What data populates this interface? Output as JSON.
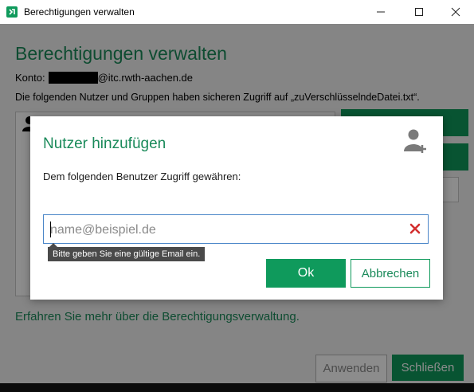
{
  "window": {
    "title": "Berechtigungen verwalten",
    "accent_color": "#0f9a5c",
    "icons": {
      "app": "app-logo-icon",
      "minimize": "minimize-icon",
      "maximize": "maximize-icon",
      "close": "close-icon"
    }
  },
  "base": {
    "heading": "Berechtigungen verwalten",
    "account_label": "Konto:",
    "account_suffix": "@itc.rwth-aachen.de",
    "access_text": "Die folgenden Nutzer und Gruppen haben sicheren Zugriff auf „zuVerschlüsselndeDatei.txt“.",
    "learn_more": "Erfahren Sie mehr über die Berechtigungsverwaltung.",
    "apply_label": "Anwenden",
    "close_label": "Schließen"
  },
  "modal": {
    "title": "Nutzer hinzufügen",
    "description": "Dem folgenden Benutzer Zugriff gewähren:",
    "email_placeholder": "name@beispiel.de",
    "email_value": "",
    "validation_tooltip": "Bitte geben Sie eine gültige Email ein.",
    "ok_label": "Ok",
    "cancel_label": "Abbrechen",
    "icons": {
      "add_user": "add-user-icon",
      "clear": "clear-x-icon"
    },
    "error_color": "#d32f2f"
  }
}
